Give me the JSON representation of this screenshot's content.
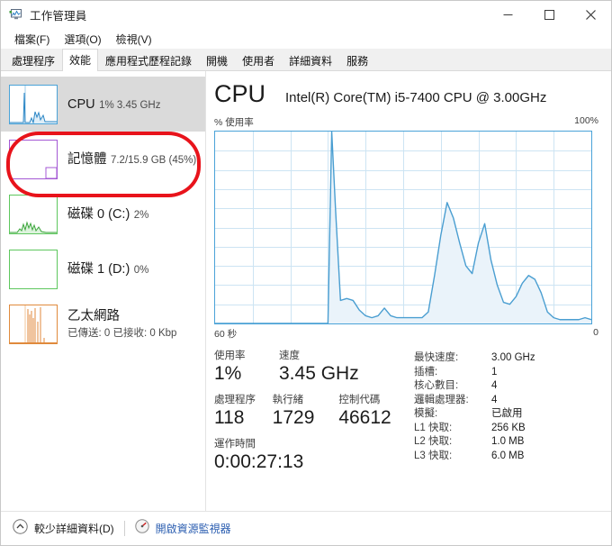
{
  "window": {
    "title": "工作管理員",
    "icon": "task-manager-icon",
    "minimize_label": "─",
    "maximize_label": "□",
    "close_label": "✕"
  },
  "menu": [
    {
      "label": "檔案(F)"
    },
    {
      "label": "選項(O)"
    },
    {
      "label": "檢視(V)"
    }
  ],
  "tabs": [
    {
      "label": "處理程序",
      "active": false
    },
    {
      "label": "效能",
      "active": true
    },
    {
      "label": "應用程式歷程記錄",
      "active": false
    },
    {
      "label": "開機",
      "active": false
    },
    {
      "label": "使用者",
      "active": false
    },
    {
      "label": "詳細資料",
      "active": false
    },
    {
      "label": "服務",
      "active": false
    }
  ],
  "sidebar": {
    "items": [
      {
        "key": "cpu",
        "title": "CPU",
        "subtitle": "1%  3.45 GHz",
        "selected": true,
        "color": "#4aa3d8"
      },
      {
        "key": "memory",
        "title": "記憶體",
        "subtitle": "7.2/15.9 GB (45%)",
        "selected": false,
        "color": "#a458d4"
      },
      {
        "key": "disk0",
        "title": "磁碟 0 (C:)",
        "subtitle": "2%",
        "selected": false,
        "color": "#5ec75e"
      },
      {
        "key": "disk1",
        "title": "磁碟 1 (D:)",
        "subtitle": "0%",
        "selected": false,
        "color": "#5ec75e"
      },
      {
        "key": "ethernet",
        "title": "乙太網路",
        "subtitle": "已傳送: 0 已接收: 0 Kbp",
        "selected": false,
        "color": "#e08a3c"
      }
    ]
  },
  "main": {
    "heading": "CPU",
    "device_name": "Intel(R) Core(TM) i5-7400 CPU @ 3.00GHz",
    "y_axis_label": "% 使用率",
    "y_axis_max": "100%",
    "x_axis_left": "60 秒",
    "x_axis_right": "0",
    "stats": {
      "row1": [
        {
          "label": "使用率",
          "value": "1%",
          "w": "w1"
        },
        {
          "label": "速度",
          "value": "3.45 GHz",
          "w": "w2"
        }
      ],
      "row2": [
        {
          "label": "處理程序",
          "value": "118",
          "w": "w1"
        },
        {
          "label": "執行緒",
          "value": "1729",
          "w": "w3"
        },
        {
          "label": "控制代碼",
          "value": "46612",
          "w": "w3"
        }
      ],
      "row3": [
        {
          "label": "運作時間",
          "value": "0:00:27:13",
          "w": "w2"
        }
      ]
    },
    "details": [
      {
        "key": "最快速度:",
        "value": "3.00 GHz"
      },
      {
        "key": "插槽:",
        "value": "1"
      },
      {
        "key": "核心數目:",
        "value": "4"
      },
      {
        "key": "邏輯處理器:",
        "value": "4"
      },
      {
        "key": "模擬:",
        "value": "已啟用"
      },
      {
        "key": "L1 快取:",
        "value": "256 KB"
      },
      {
        "key": "L2 快取:",
        "value": "1.0 MB"
      },
      {
        "key": "L3 快取:",
        "value": "6.0 MB"
      }
    ]
  },
  "footer": {
    "collapse_icon": "chevron-up-circle-icon",
    "collapse_label": "較少詳細資料(D)",
    "resource_icon": "resource-monitor-icon",
    "resource_label": "開啟資源監視器"
  },
  "annotation": {
    "shape": "red-ellipse-highlight",
    "target": "sidebar-item-memory",
    "color": "#e8131b"
  },
  "chart_data": {
    "type": "area",
    "title": "CPU 使用率",
    "xlabel": "60 秒",
    "ylabel": "% 使用率",
    "xlim": [
      0,
      60
    ],
    "ylim": [
      0,
      100
    ],
    "grid": true,
    "grid_cols": 10,
    "grid_rows": 10,
    "line_color": "#4a9ed1",
    "fill_color": "#eaf3fa",
    "legend": "none",
    "x": [
      0,
      3,
      6,
      9,
      12,
      15,
      17,
      18,
      18.6,
      19.2,
      20,
      21,
      22,
      23,
      24,
      25,
      26,
      27,
      28,
      29,
      30,
      31,
      32,
      33,
      34,
      35,
      36,
      37,
      38,
      39,
      40,
      41,
      42,
      43,
      44,
      45,
      46,
      47,
      48,
      49,
      50,
      51,
      52,
      53,
      54,
      55,
      56,
      57,
      58,
      59,
      60
    ],
    "values": [
      0,
      0,
      0,
      0,
      0,
      0,
      0,
      0,
      100,
      60,
      12,
      13,
      12,
      7,
      4,
      3,
      4,
      8,
      4,
      3,
      3,
      3,
      3,
      3,
      6,
      25,
      46,
      63,
      55,
      42,
      30,
      26,
      42,
      52,
      33,
      20,
      11,
      10,
      14,
      21,
      25,
      23,
      16,
      6,
      3,
      2,
      2,
      2,
      2,
      3,
      2
    ]
  }
}
